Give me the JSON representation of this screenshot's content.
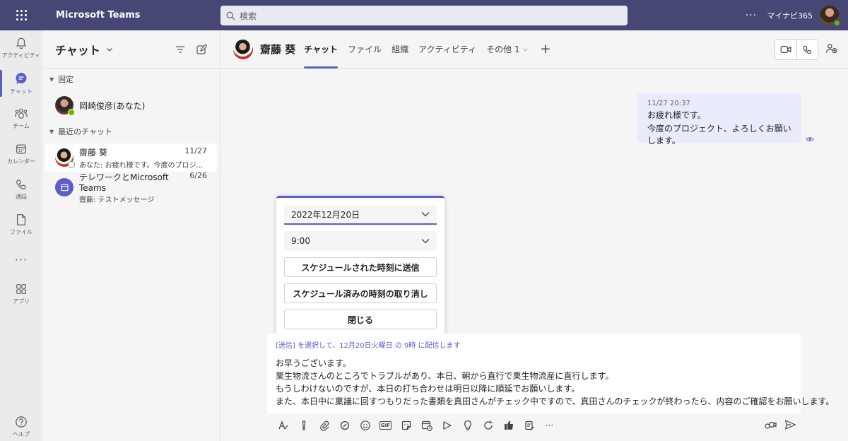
{
  "app": {
    "title": "Microsoft Teams",
    "search_placeholder": "検索",
    "org": "マイナビ365",
    "more": "···"
  },
  "rail": {
    "activity": "アクティビティ",
    "chat": "チャット",
    "teams": "チーム",
    "calendar": "カレンダー",
    "calls": "通話",
    "files": "ファイル",
    "more": "···",
    "apps": "アプリ",
    "help": "ヘルプ"
  },
  "list": {
    "title": "チャット",
    "pinned_label": "固定",
    "recent_label": "最近のチャット",
    "pinned": [
      {
        "name": "岡崎俊彦(あなた)"
      }
    ],
    "recent": [
      {
        "name": "齋藤 葵",
        "date": "11/27",
        "preview": "あなた: お疲れ様です。今度のプロジ..."
      },
      {
        "name": "テレワークとMicrosoft Teams",
        "date": "6/26",
        "preview": "齋藤: テストメッセージ"
      }
    ]
  },
  "header": {
    "name": "齋藤 葵",
    "tabs": [
      "チャット",
      "ファイル",
      "組織",
      "アクティビティ"
    ],
    "more_tab": "その他 1"
  },
  "message": {
    "timestamp": "11/27 20:37",
    "line1": "お疲れ様です。",
    "line2": "今度のプロジェクト、よろしくお願いします。"
  },
  "schedule": {
    "date": "2022年12月20日",
    "time": "9:00",
    "send_btn": "スケジュールされた時刻に送信",
    "cancel_btn": "スケジュール済みの時刻の取り消し",
    "close_btn": "閉じる"
  },
  "compose": {
    "note": "[送信] を選択して、12月20日火曜日 の 9時 に配信します",
    "lines": [
      "お早うございます。",
      "栗生物流さんのところでトラブルがあり、本日、朝から直行で栗生物流産に直行します。",
      "もうしわけないのですが、本日の打ち合わせは明日以降に順延でお願いします。",
      "また、本日中に稟議に回すつもりだった書類を真田さんがチェック中ですので、真田さんのチェックが終わったら、内容のご確認をお願いします。"
    ],
    "gif_label": "GIF",
    "more": "···"
  },
  "colors": {
    "brand": "#464775",
    "accent": "#5b5fc7",
    "online": "#6bb700"
  }
}
